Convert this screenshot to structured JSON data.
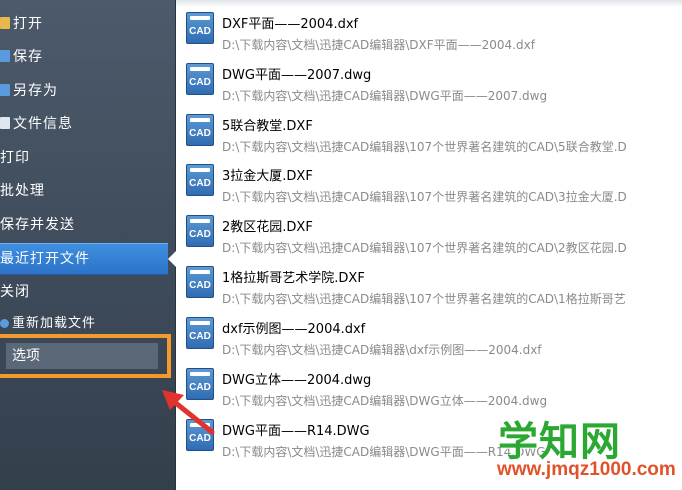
{
  "sidebar": {
    "items": [
      {
        "label": "打开",
        "icon": "folder-open-icon",
        "icon_color": "#e8b84a"
      },
      {
        "label": "保存",
        "icon": "save-icon",
        "icon_color": "#5a9be0"
      },
      {
        "label": "另存为",
        "icon": "save-as-icon",
        "icon_color": "#5a9be0"
      },
      {
        "label": "文件信息",
        "icon": "file-info-icon",
        "icon_color": "#dfe6ee"
      },
      {
        "label": "打印",
        "icon": "",
        "icon_color": ""
      },
      {
        "label": "批处理",
        "icon": "",
        "icon_color": ""
      },
      {
        "label": "保存并发送",
        "icon": "",
        "icon_color": ""
      },
      {
        "label": "最近打开文件",
        "icon": "",
        "icon_color": "",
        "selected": true
      },
      {
        "label": "关闭",
        "icon": "",
        "icon_color": ""
      },
      {
        "label": "重新加载文件",
        "icon": "reload-icon",
        "icon_color": "#5a9be0"
      }
    ],
    "options_label": "选项",
    "highlight_color": "#f39a2f",
    "selected_color": "#2c73c9"
  },
  "recent_files": [
    {
      "name": "DXF平面——2004.dxf",
      "path": "D:\\下载内容\\文档\\迅捷CAD编辑器\\DXF平面——2004.dxf",
      "icon_text": "CAD"
    },
    {
      "name": "DWG平面——2007.dwg",
      "path": "D:\\下载内容\\文档\\迅捷CAD编辑器\\DWG平面——2007.dwg",
      "icon_text": "CAD"
    },
    {
      "name": "5联合教堂.DXF",
      "path": "D:\\下载内容\\文档\\迅捷CAD编辑器\\107个世界著名建筑的CAD\\5联合教堂.D",
      "icon_text": "CAD"
    },
    {
      "name": "3拉金大厦.DXF",
      "path": "D:\\下载内容\\文档\\迅捷CAD编辑器\\107个世界著名建筑的CAD\\3拉金大厦.D",
      "icon_text": "CAD"
    },
    {
      "name": "2教区花园.DXF",
      "path": "D:\\下载内容\\文档\\迅捷CAD编辑器\\107个世界著名建筑的CAD\\2教区花园.D",
      "icon_text": "CAD"
    },
    {
      "name": "1格拉斯哥艺术学院.DXF",
      "path": "D:\\下载内容\\文档\\迅捷CAD编辑器\\107个世界著名建筑的CAD\\1格拉斯哥艺",
      "icon_text": "CAD"
    },
    {
      "name": "dxf示例图——2004.dxf",
      "path": "D:\\下载内容\\文档\\迅捷CAD编辑器\\dxf示例图——2004.dxf",
      "icon_text": "CAD"
    },
    {
      "name": "DWG立体——2004.dwg",
      "path": "D:\\下载内容\\文档\\迅捷CAD编辑器\\DWG立体——2004.dwg",
      "icon_text": "CAD"
    },
    {
      "name": "DWG平面——R14.DWG",
      "path": "D:\\下载内容\\文档\\迅捷CAD编辑器\\DWG平面——R14.DWG",
      "icon_text": "CAD"
    }
  ],
  "annotation": {
    "arrow_color": "#e2322e"
  },
  "watermark": {
    "title": "学知网",
    "url": "www.jmqz1000.com"
  }
}
